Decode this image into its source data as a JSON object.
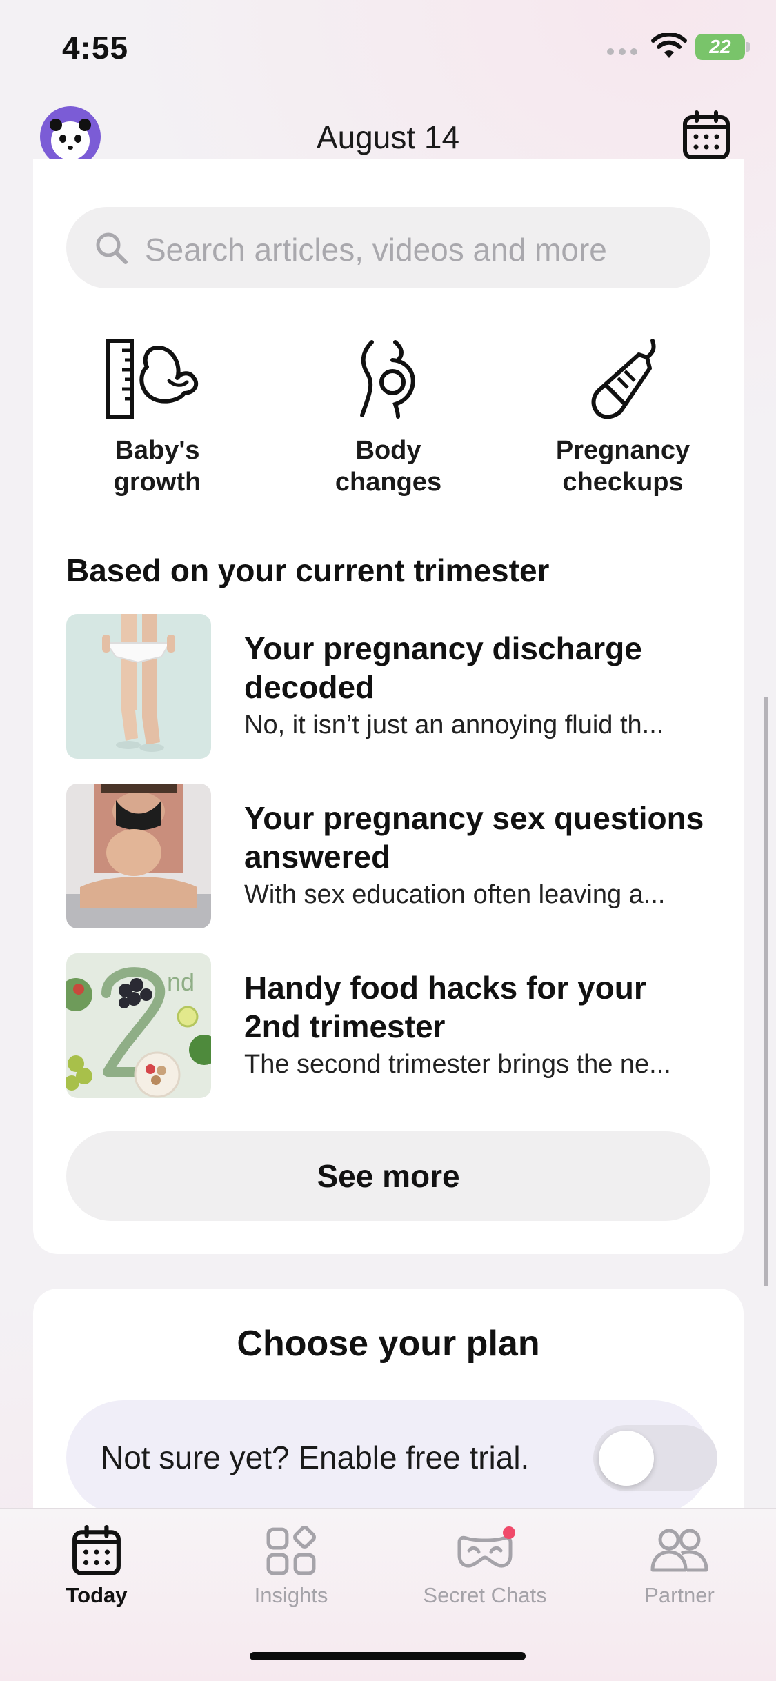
{
  "status_bar": {
    "time": "4:55",
    "battery": "22"
  },
  "header": {
    "title": "August 14"
  },
  "search": {
    "placeholder": "Search articles, videos and more"
  },
  "categories": [
    {
      "label_line1": "Baby's",
      "label_line2": "growth",
      "icon": "baby-growth-icon"
    },
    {
      "label_line1": "Body",
      "label_line2": "changes",
      "icon": "body-changes-icon"
    },
    {
      "label_line1": "Pregnancy",
      "label_line2": "checkups",
      "icon": "ultrasound-probe-icon"
    }
  ],
  "section": {
    "title": "Based on your current trimester"
  },
  "articles": [
    {
      "title": "Your pregnancy discharge decoded",
      "description": "No, it isn’t just an annoying fluid th..."
    },
    {
      "title": "Your pregnancy sex questions answered",
      "description": "With sex education often leaving a..."
    },
    {
      "title": "Handy food hacks for your 2nd trimester",
      "description": "The second trimester brings the ne...",
      "thumb_text": "nd"
    }
  ],
  "see_more": {
    "label": "See more"
  },
  "plan": {
    "title": "Choose your plan",
    "trial_text": "Not sure yet? Enable free trial.",
    "trial_enabled": false
  },
  "tabs": [
    {
      "label": "Today",
      "icon": "calendar-icon",
      "active": true
    },
    {
      "label": "Insights",
      "icon": "insights-icon",
      "active": false
    },
    {
      "label": "Secret Chats",
      "icon": "mask-icon",
      "active": false,
      "badge_color": "#f04a6a"
    },
    {
      "label": "Partner",
      "icon": "partner-icon",
      "active": false
    }
  ],
  "colors": {
    "accent": "#7b5cd6",
    "badge": "#f04a6a",
    "battery": "#79c46a"
  }
}
